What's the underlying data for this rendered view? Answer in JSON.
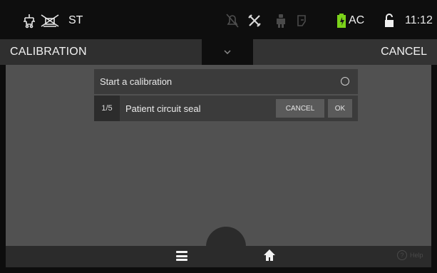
{
  "status_bar": {
    "mode_text": "ST",
    "power_text": "AC",
    "time": "11:12",
    "icons": [
      "patient-circuit-icon",
      "no-patient-icon",
      "alarm-silenced-icon",
      "tools-icon",
      "patient-icon",
      "lung-icon",
      "battery-icon",
      "lock-icon"
    ],
    "battery_color": "#7bd21a"
  },
  "title_bar": {
    "title": "CALIBRATION",
    "cancel_label": "CANCEL"
  },
  "calibration": {
    "start_label": "Start a calibration",
    "step_number": "1/5",
    "step_label": "Patient circuit seal",
    "cancel_label": "CANCEL",
    "ok_label": "OK"
  },
  "bottom_bar": {
    "help_label": "Help"
  }
}
